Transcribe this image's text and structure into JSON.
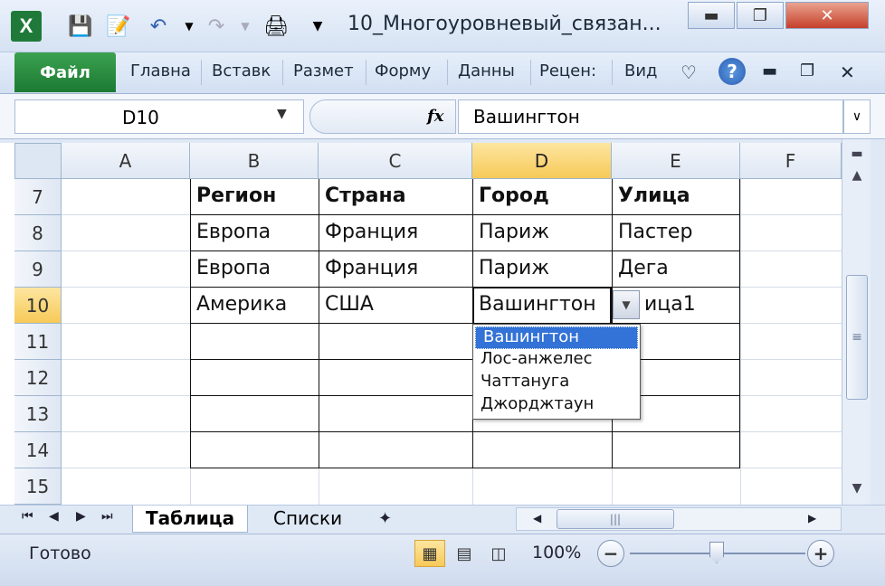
{
  "window": {
    "title": "10_Многоуровневый_связан...",
    "minimize_icon": "minimize-icon",
    "restore_icon": "restore-icon",
    "close_icon": "close-icon"
  },
  "ribbon": {
    "file_label": "Файл",
    "tabs": [
      "Главна",
      "Вставк",
      "Размет",
      "Форму",
      "Данны",
      "Рецен:",
      "Вид"
    ]
  },
  "formula_bar": {
    "name_box": "D10",
    "fx_label": "fx",
    "value": "Вашингтон"
  },
  "columns": [
    "A",
    "B",
    "C",
    "D",
    "E",
    "F"
  ],
  "active_column": "D",
  "rows": [
    "7",
    "8",
    "9",
    "10",
    "11",
    "12",
    "13",
    "14",
    "15"
  ],
  "active_row": "10",
  "table": {
    "header": [
      "Регион",
      "Страна",
      "Город",
      "Улица"
    ],
    "rows": [
      [
        "Европа",
        "Франция",
        "Париж",
        "Пастер"
      ],
      [
        "Европа",
        "Франция",
        "Париж",
        "Дега"
      ],
      [
        "Америка",
        "США",
        "Вашингтон",
        "ица1"
      ]
    ]
  },
  "dropdown": {
    "options": [
      "Вашингтон",
      "Лос-анжелес",
      "Чаттануга",
      "Джорджтаун"
    ],
    "selected_index": 0
  },
  "sheets": {
    "tabs": [
      "Таблица",
      "Списки"
    ],
    "active": "Таблица"
  },
  "status": {
    "text": "Готово",
    "zoom": "100%",
    "zoom_percent": 100
  },
  "colors": {
    "active_header": "#f7c958",
    "selection": "#3372d6",
    "file_tab": "#1d7a33"
  }
}
